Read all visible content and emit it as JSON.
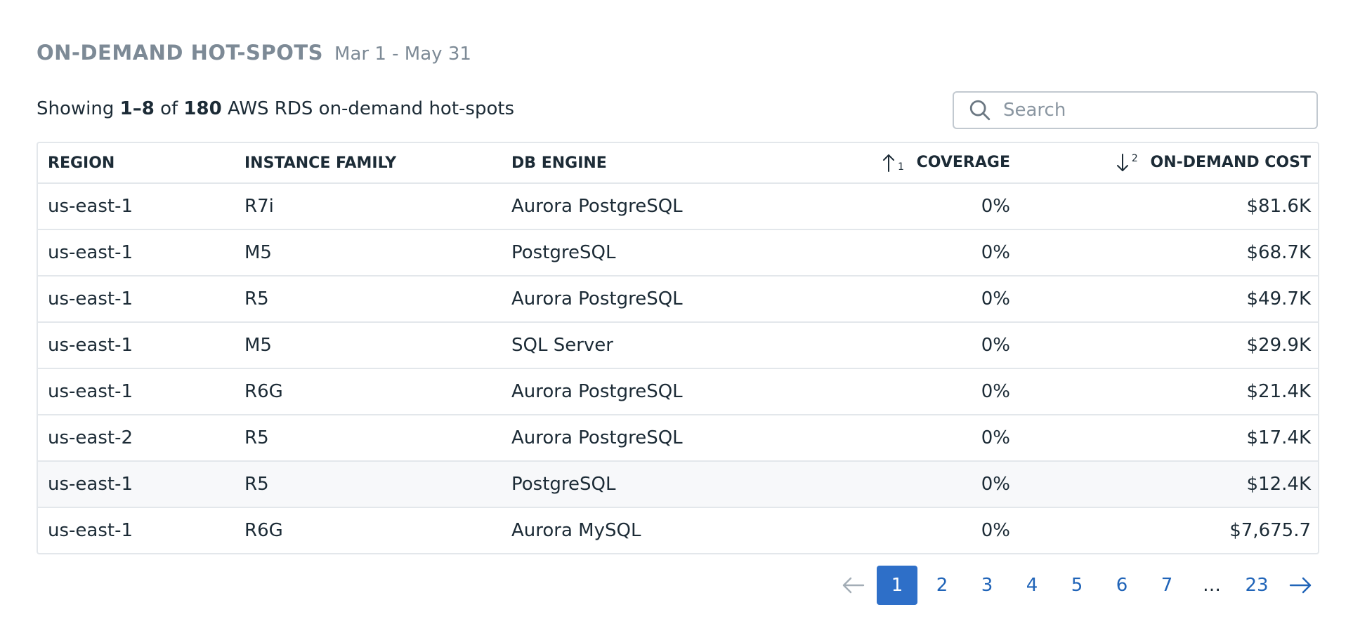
{
  "header": {
    "title": "ON-DEMAND HOT-SPOTS",
    "date_range": "Mar 1 - May 31"
  },
  "summary": {
    "prefix": "Showing",
    "range": "1–8",
    "of": "of",
    "total": "180",
    "suffix": "AWS RDS on-demand hot-spots"
  },
  "search": {
    "placeholder": "Search",
    "value": "",
    "icon": "search-icon"
  },
  "table": {
    "columns": [
      {
        "label": "REGION"
      },
      {
        "label": "INSTANCE FAMILY"
      },
      {
        "label": "DB ENGINE"
      },
      {
        "label": "COVERAGE",
        "sort": "ascending",
        "sort_order": "1"
      },
      {
        "label": "ON-DEMAND COST",
        "sort": "descending",
        "sort_order": "2"
      }
    ],
    "rows": [
      {
        "region": "us-east-1",
        "family": "R7i",
        "engine": "Aurora PostgreSQL",
        "coverage": "0%",
        "cost": "$81.6K"
      },
      {
        "region": "us-east-1",
        "family": "M5",
        "engine": "PostgreSQL",
        "coverage": "0%",
        "cost": "$68.7K"
      },
      {
        "region": "us-east-1",
        "family": "R5",
        "engine": "Aurora PostgreSQL",
        "coverage": "0%",
        "cost": "$49.7K"
      },
      {
        "region": "us-east-1",
        "family": "M5",
        "engine": "SQL Server",
        "coverage": "0%",
        "cost": "$29.9K"
      },
      {
        "region": "us-east-1",
        "family": "R6G",
        "engine": "Aurora PostgreSQL",
        "coverage": "0%",
        "cost": "$21.4K"
      },
      {
        "region": "us-east-2",
        "family": "R5",
        "engine": "Aurora PostgreSQL",
        "coverage": "0%",
        "cost": "$17.4K"
      },
      {
        "region": "us-east-1",
        "family": "R5",
        "engine": "PostgreSQL",
        "coverage": "0%",
        "cost": "$12.4K",
        "hovered": true
      },
      {
        "region": "us-east-1",
        "family": "R6G",
        "engine": "Aurora MySQL",
        "coverage": "0%",
        "cost": "$7,675.7"
      }
    ]
  },
  "pagination": {
    "current": "1",
    "pages": [
      "1",
      "2",
      "3",
      "4",
      "5",
      "6",
      "7",
      "…",
      "23"
    ],
    "prev_icon": "arrow-left-icon",
    "next_icon": "arrow-right-icon"
  },
  "colors": {
    "accent": "#2e6fc8",
    "link": "#2064b8",
    "title": "#7d8a96",
    "border": "#e3e7eb"
  }
}
